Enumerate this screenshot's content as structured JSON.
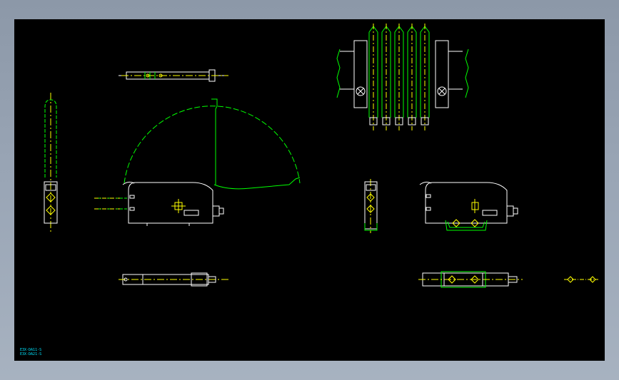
{
  "drawing": {
    "colors": {
      "background": "#000000",
      "outline": "#ffffff",
      "hidden": "#00ff00",
      "center": "#ffff00",
      "label": "#00e5ff",
      "frame": "#94a0b0"
    },
    "info_lines": [
      "E3X-DA11-S",
      "E3X-DA21-S"
    ]
  }
}
